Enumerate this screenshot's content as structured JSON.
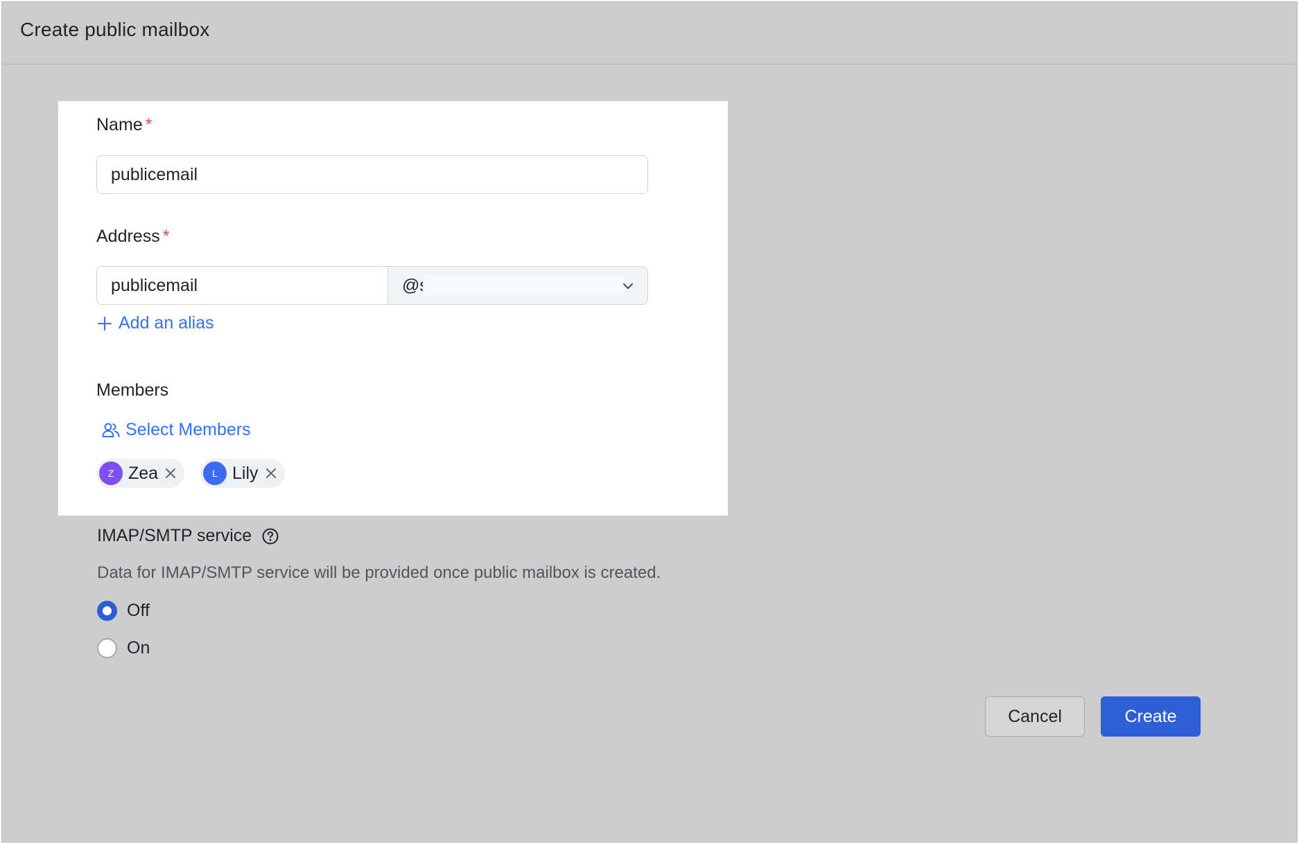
{
  "dialog": {
    "title": "Create public mailbox"
  },
  "form": {
    "name": {
      "label": "Name",
      "required_mark": "*",
      "value": "publicemail"
    },
    "address": {
      "label": "Address",
      "required_mark": "*",
      "local_value": "publicemail",
      "domain_prefix": "@s",
      "add_alias_label": "Add an alias"
    },
    "members": {
      "label": "Members",
      "select_label": "Select Members",
      "items": [
        {
          "initial": "Z",
          "name": "Zea",
          "avatar_color": "#7b4ff0"
        },
        {
          "initial": "L",
          "name": "Lily",
          "avatar_color": "#3b6cf0"
        }
      ]
    },
    "imap": {
      "label": "IMAP/SMTP service",
      "description": "Data for IMAP/SMTP service will be provided once public mailbox is created.",
      "options": [
        {
          "label": "Off",
          "selected": true
        },
        {
          "label": "On",
          "selected": false
        }
      ]
    }
  },
  "actions": {
    "cancel_label": "Cancel",
    "create_label": "Create"
  },
  "colors": {
    "accent": "#3370ff",
    "primary_button": "#2f5fd6",
    "required": "#e5484d",
    "overlay": "#cdcdcd"
  }
}
